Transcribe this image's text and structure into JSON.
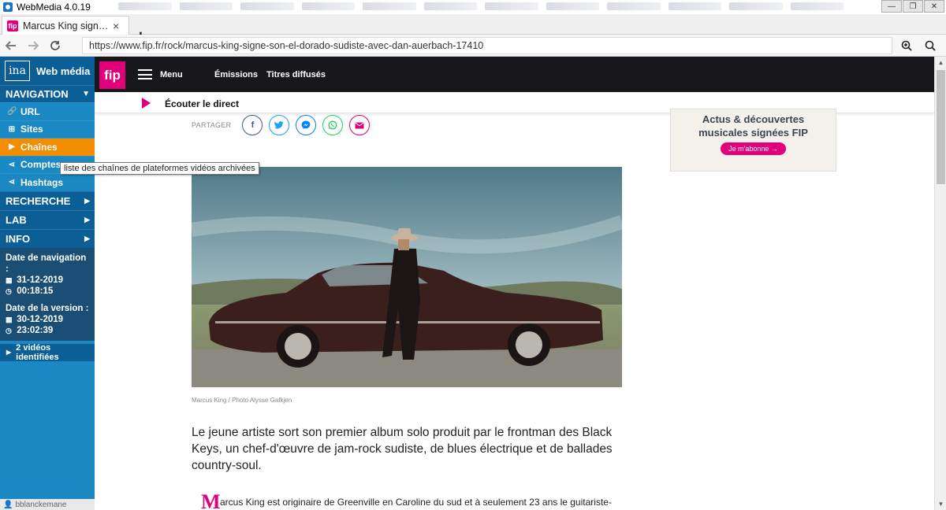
{
  "window": {
    "title": "WebMedia 4.0.19",
    "buttons": [
      "—",
      "❐",
      "✕"
    ]
  },
  "browser": {
    "tab_label": "Marcus King sign…",
    "tab_close": "×",
    "new_tab": "+",
    "url": "https://www.fip.fr/rock/marcus-king-signe-son-el-dorado-sudiste-avec-dan-auerbach-17410"
  },
  "sidebar": {
    "logo": "ina",
    "brand": "Web média",
    "navigation_header": "NAVIGATION",
    "items": [
      {
        "label": "URL",
        "icon": "link-icon"
      },
      {
        "label": "Sites",
        "icon": "sitemap-icon"
      },
      {
        "label": "Chaînes",
        "icon": "youtube-icon",
        "active": true
      },
      {
        "label": "Comptes",
        "icon": "share-icon"
      },
      {
        "label": "Hashtags",
        "icon": "share-icon"
      }
    ],
    "sections": [
      "RECHERCHE",
      "LAB",
      "INFO"
    ],
    "nav_date_label": "Date de navigation :",
    "nav_date": "31-12-2019",
    "nav_time": "00:18:15",
    "version_date_label": "Date de la version :",
    "version_date": "30-12-2019",
    "version_time": "23:02:39",
    "videos": "2 vidéos identifiées",
    "user": "bblanckemane"
  },
  "tooltip": "liste des chaînes de plateformes vidéos archivées",
  "fip": {
    "logo": "fip",
    "menu": "Menu",
    "emissions": "Émissions",
    "titres": "Titres diffusés",
    "live": "Écouter le direct",
    "share_label": "PARTAGER",
    "share_icons": [
      {
        "name": "facebook-icon",
        "glyph": "f",
        "color": "#3b5998"
      },
      {
        "name": "twitter-icon",
        "glyph": "t",
        "color": "#1da1f2"
      },
      {
        "name": "messenger-icon",
        "glyph": "m",
        "color": "#0084ff"
      },
      {
        "name": "whatsapp-icon",
        "glyph": "w",
        "color": "#25d366"
      },
      {
        "name": "email-icon",
        "glyph": "✉",
        "color": "#e2007a"
      }
    ],
    "promo_line1": "Actus & découvertes",
    "promo_line2": "musicales signées FIP",
    "promo_button": "Je m'abonne →",
    "caption": "Marcus King / Photo Alysse Gafkjen",
    "lead": "Le jeune artiste sort son premier album solo produit par le frontman des Black Keys, un chef-d'œuvre de jam-rock sudiste, de blues électrique et de ballades country-soul.",
    "dropcap": "M",
    "body_start": "arcus King est originaire de Greenville en Caroline du sud et à seulement 23 ans le guitariste-"
  },
  "colors": {
    "accent": "#e2007a",
    "sidebar": "#1a88c2",
    "sidebar_dark": "#0b5e96",
    "active": "#f28c00"
  }
}
